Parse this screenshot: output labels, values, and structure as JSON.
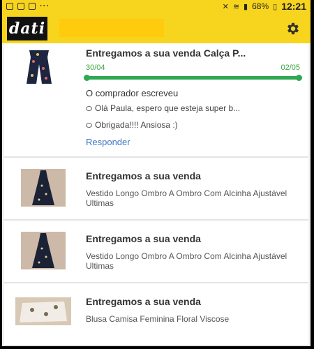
{
  "status_bar": {
    "battery": "68%",
    "time": "12:21",
    "dots": "···"
  },
  "app": {
    "logo_text": "dati",
    "settings_icon": "gear-icon"
  },
  "orders": [
    {
      "title": "Entregamos a sua venda Calça P...",
      "progress": {
        "start": "30/04",
        "end": "02/05",
        "fraction": 1.0
      },
      "buyer_label": "O comprador escreveu",
      "messages": [
        "Olá Paula, espero que esteja super b...",
        "Obrigada!!!! Ansiosa :)"
      ],
      "reply_label": "Responder"
    },
    {
      "title": "Entregamos a sua venda",
      "description": "Vestido Longo Ombro A Ombro Com Alcinha Ajustável Ultimas"
    },
    {
      "title": "Entregamos a sua venda",
      "description": "Vestido Longo Ombro A Ombro Com Alcinha Ajustável Ultimas"
    },
    {
      "title": "Entregamos a sua venda",
      "description": "Blusa Camisa Feminina Floral Viscose"
    }
  ],
  "colors": {
    "accent_yellow": "#f7d51e",
    "progress_green": "#2fa84f",
    "link_blue": "#3d77c6"
  }
}
